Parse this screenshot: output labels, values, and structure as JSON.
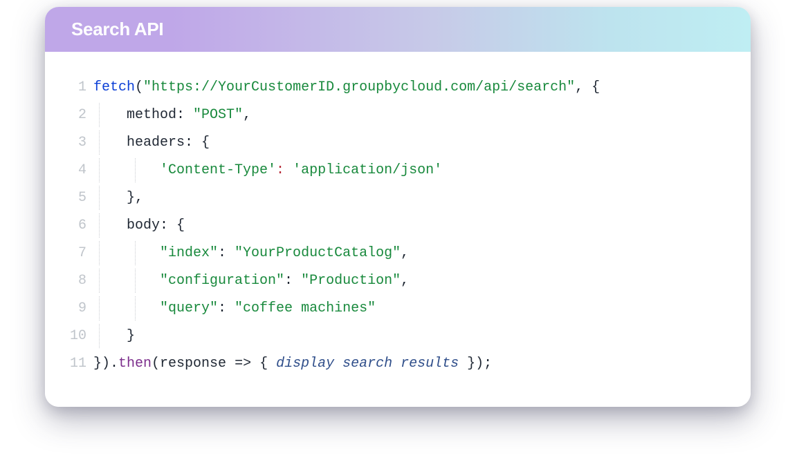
{
  "header": {
    "title": "Search API"
  },
  "line_numbers": [
    "1",
    "2",
    "3",
    "4",
    "5",
    "6",
    "7",
    "8",
    "9",
    "10",
    "11"
  ],
  "l1": {
    "fetch": "fetch",
    "open": "(",
    "url": "\"https://YourCustomerID.groupbycloud.com/api/search\"",
    "tail": ", {"
  },
  "l2": {
    "indent": "    ",
    "key": "method:",
    "sp": " ",
    "val": "\"POST\"",
    "tail": ","
  },
  "l3": {
    "indent": "    ",
    "key": "headers:",
    "sp": " ",
    "brace": "{"
  },
  "l4": {
    "indent": "        ",
    "key": "'Content-Type'",
    "colon": ": ",
    "val": "'application/json'"
  },
  "l5": {
    "indent": "    ",
    "brace": "}",
    "tail": ","
  },
  "l6": {
    "indent": "    ",
    "key": "body:",
    "sp": " ",
    "brace": "{"
  },
  "l7": {
    "indent": "        ",
    "key": "\"index\"",
    "colon": ": ",
    "val": "\"YourProductCatalog\"",
    "tail": ","
  },
  "l8": {
    "indent": "        ",
    "key": "\"configuration\"",
    "colon": ": ",
    "val": "\"Production\"",
    "tail": ","
  },
  "l9": {
    "indent": "        ",
    "key": "\"query\"",
    "colon": ": ",
    "val": "\"coffee machines\""
  },
  "l10": {
    "indent": "    ",
    "brace": "}"
  },
  "l11": {
    "close": "}).",
    "then": "then",
    "open": "(",
    "arg": "response",
    "arrow": " => { ",
    "comment": "display search results",
    "tail": " });"
  }
}
